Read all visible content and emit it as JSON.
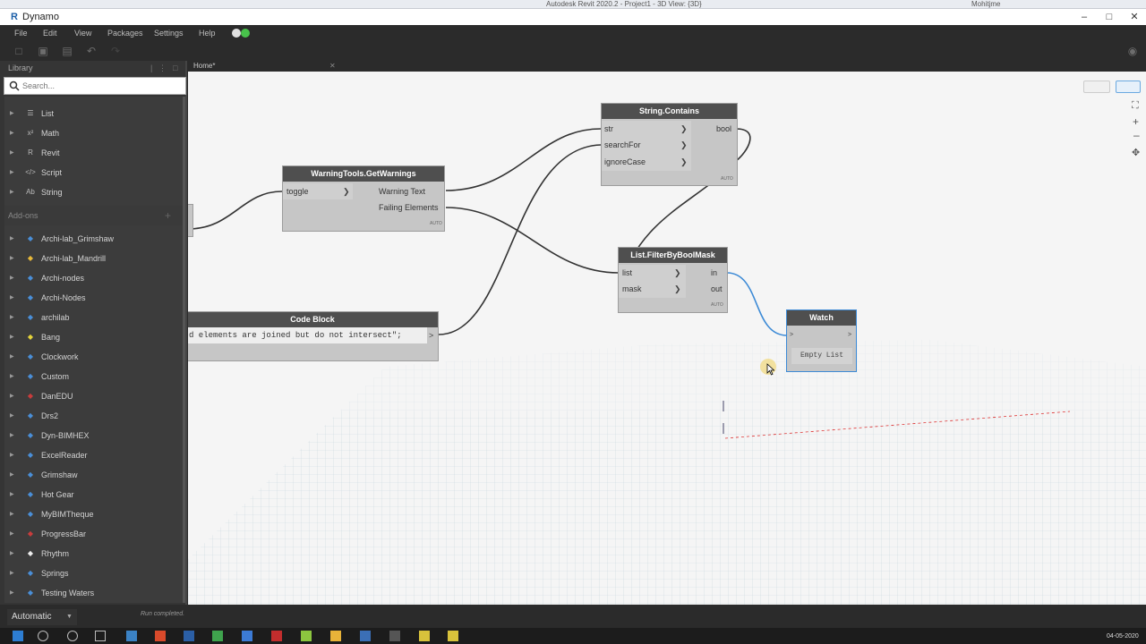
{
  "revit": {
    "title": "Autodesk Revit 2020.2 - Project1 - 3D View: {3D}",
    "user": "Mohitjme"
  },
  "window": {
    "title": "Dynamo",
    "minimize": "–",
    "maximize": "□",
    "close": "✕"
  },
  "menu": [
    "File",
    "Edit",
    "View",
    "Packages",
    "Settings",
    "Help"
  ],
  "library": {
    "title": "Library",
    "search_placeholder": "Search...",
    "items": [
      {
        "label": "List",
        "icon": "list-icon",
        "glyph": "☰"
      },
      {
        "label": "Math",
        "icon": "math-icon",
        "glyph": "x²"
      },
      {
        "label": "Revit",
        "icon": "revit-icon",
        "glyph": "R"
      },
      {
        "label": "Script",
        "icon": "script-icon",
        "glyph": "</>"
      },
      {
        "label": "String",
        "icon": "string-icon",
        "glyph": "Ab"
      }
    ],
    "addons_header": "Add-ons",
    "addons": [
      {
        "label": "Archi-lab_Grimshaw",
        "icon": "package-icon",
        "color": "#4a8fd8"
      },
      {
        "label": "Archi-lab_Mandrill",
        "icon": "mandrill-icon",
        "color": "#e8b93a"
      },
      {
        "label": "Archi-nodes",
        "icon": "package-icon",
        "color": "#4a8fd8"
      },
      {
        "label": "Archi-Nodes",
        "icon": "package-icon",
        "color": "#4a8fd8"
      },
      {
        "label": "archilab",
        "icon": "package-icon",
        "color": "#4a8fd8"
      },
      {
        "label": "Bang",
        "icon": "bang-icon",
        "color": "#e5d33a"
      },
      {
        "label": "Clockwork",
        "icon": "package-icon",
        "color": "#4a8fd8"
      },
      {
        "label": "Custom",
        "icon": "package-icon",
        "color": "#4a8fd8"
      },
      {
        "label": "DanEDU",
        "icon": "danedu-icon",
        "color": "#c93c3c"
      },
      {
        "label": "Drs2",
        "icon": "package-icon",
        "color": "#4a8fd8"
      },
      {
        "label": "Dyn-BIMHEX",
        "icon": "package-icon",
        "color": "#4a8fd8"
      },
      {
        "label": "ExcelReader",
        "icon": "package-icon",
        "color": "#4a8fd8"
      },
      {
        "label": "Grimshaw",
        "icon": "package-icon",
        "color": "#4a8fd8"
      },
      {
        "label": "Hot Gear",
        "icon": "package-icon",
        "color": "#4a8fd8"
      },
      {
        "label": "MyBIMTheque",
        "icon": "package-icon",
        "color": "#4a8fd8"
      },
      {
        "label": "ProgressBar",
        "icon": "progressbar-icon",
        "color": "#c93c3c"
      },
      {
        "label": "Rhythm",
        "icon": "rhythm-icon",
        "color": "#eeeeee"
      },
      {
        "label": "Springs",
        "icon": "package-icon",
        "color": "#4a8fd8"
      },
      {
        "label": "Testing Waters",
        "icon": "package-icon",
        "color": "#4a8fd8"
      }
    ]
  },
  "tab": {
    "label": "Home*",
    "close": "✕"
  },
  "nodes": {
    "warning_tools": {
      "title": "WarningTools.GetWarnings",
      "inputs": [
        "toggle"
      ],
      "outputs": [
        "Warning Text",
        "Failing Elements"
      ],
      "lacing": "AUTO"
    },
    "string_contains": {
      "title": "String.Contains",
      "inputs": [
        "str",
        "searchFor",
        "ignoreCase"
      ],
      "outputs": [
        "bool"
      ],
      "lacing": "AUTO"
    },
    "filter_bool_mask": {
      "title": "List.FilterByBoolMask",
      "inputs": [
        "list",
        "mask"
      ],
      "outputs": [
        "in",
        "out"
      ],
      "lacing": "AUTO"
    },
    "code_block": {
      "title": "Code Block",
      "code": "d elements are joined but do not intersect\";"
    },
    "watch": {
      "title": "Watch",
      "value": "Empty List"
    }
  },
  "status": {
    "run_mode": "Automatic",
    "message": "Run completed."
  },
  "taskbar": {
    "date": "04-05-2020"
  },
  "colors": {
    "accent_wire": "#3c8ad6",
    "wire": "#333333",
    "node_header": "#4f4f4f"
  }
}
